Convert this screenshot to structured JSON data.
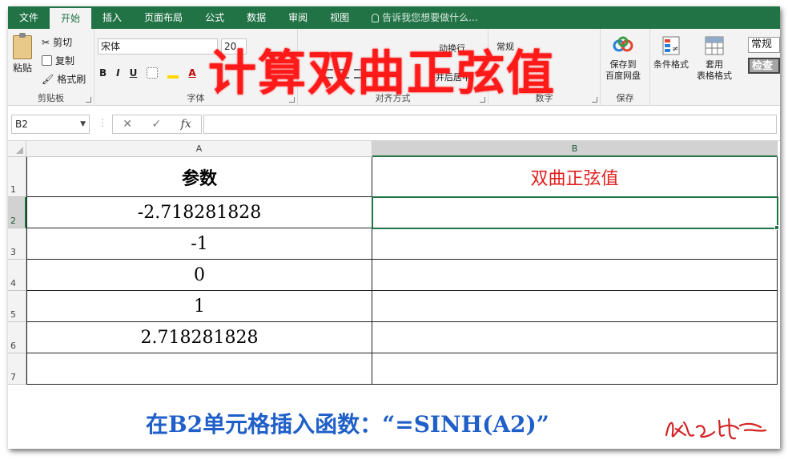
{
  "menu": {
    "tabs": [
      "文件",
      "开始",
      "插入",
      "页面布局",
      "公式",
      "数据",
      "审阅",
      "视图"
    ],
    "active_tab": "开始",
    "tell_me": "告诉我您想要做什么..."
  },
  "ribbon": {
    "clipboard": {
      "paste": "粘贴",
      "cut": "剪切",
      "copy": "复制",
      "format_painter": "格式刷",
      "label": "剪贴板"
    },
    "font": {
      "name": "宋体",
      "size": "20",
      "bold": "B",
      "italic": "I",
      "underline": "U",
      "label": "字体"
    },
    "alignment": {
      "wrap_partial": "动换行",
      "merge_partial": "并后居中",
      "label": "对齐方式"
    },
    "number": {
      "format_partial": "常规",
      "label": "数字"
    },
    "save": {
      "button": "保存到\n百度网盘",
      "line1": "保存到",
      "line2": "百度网盘",
      "label": "保存"
    },
    "styles": {
      "conditional": "条件格式",
      "table_line1": "套用",
      "table_line2": "表格格式",
      "normal": "常规",
      "check": "检查"
    }
  },
  "overlay_title": "计算双曲正弦值",
  "formula_bar": {
    "name_box": "B2",
    "cancel": "✕",
    "enter": "✓",
    "fx": "fx",
    "content": ""
  },
  "columns": [
    "A",
    "B"
  ],
  "rows": [
    "1",
    "2",
    "3",
    "4",
    "5",
    "6",
    "7"
  ],
  "table": {
    "header_a": "参数",
    "header_b": "双曲正弦值",
    "values": [
      "-2.718281828",
      "-1",
      "0",
      "1",
      "2.718281828"
    ]
  },
  "caption": "在B2单元格插入函数：“=SINH(A2)”",
  "colors": {
    "excel_green": "#217346",
    "title_red": "#ff1a1a",
    "caption_blue": "#1f5fc8"
  }
}
